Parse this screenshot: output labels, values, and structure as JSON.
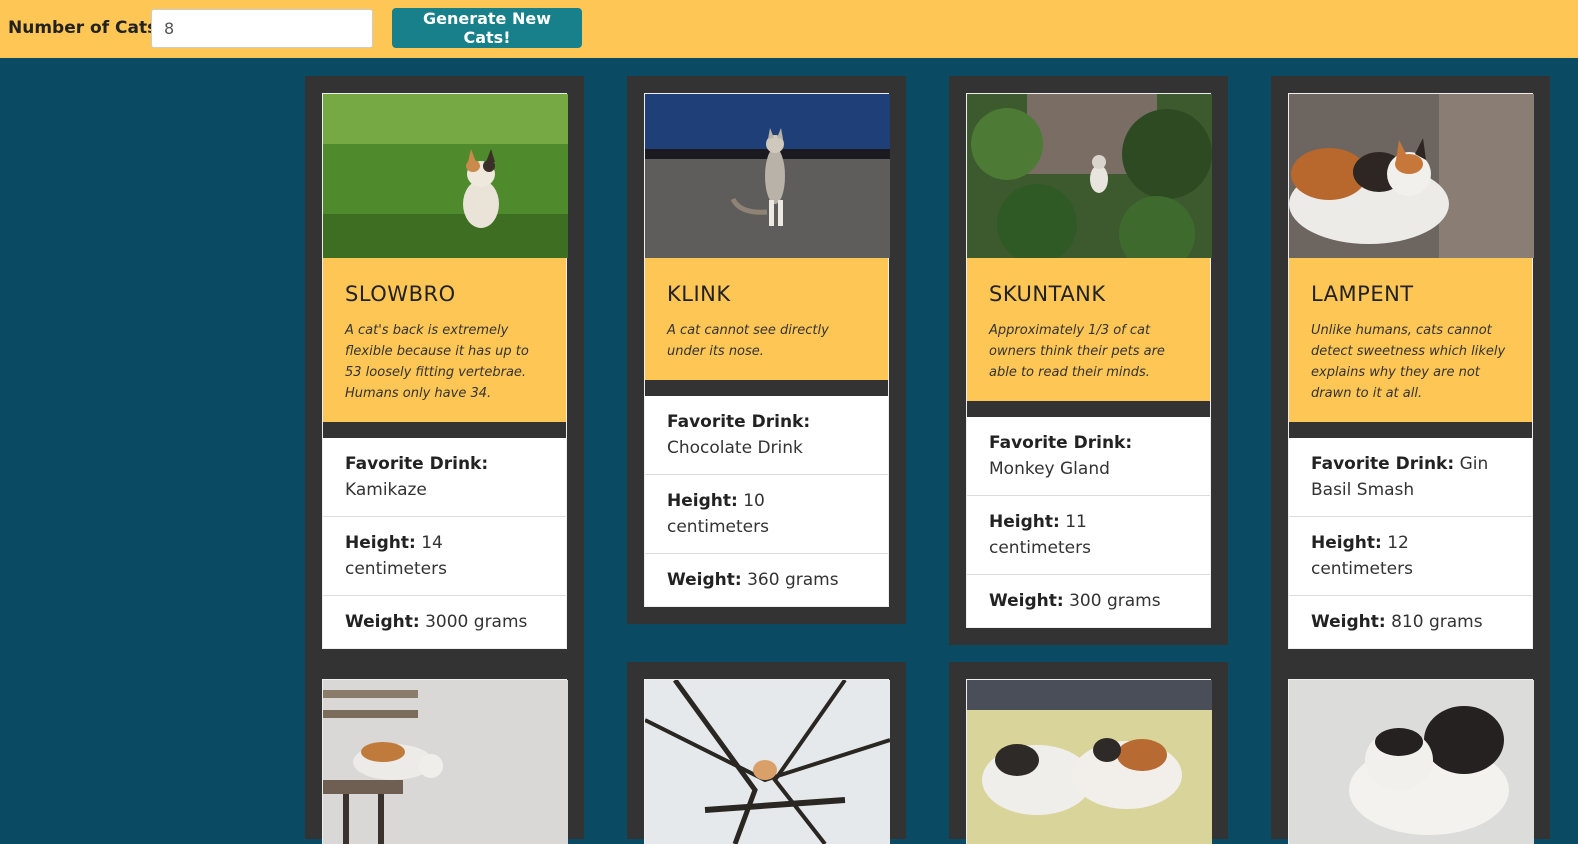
{
  "topbar": {
    "label": "Number of Cats:",
    "count_value": "8",
    "button_label": "Generate New Cats!"
  },
  "stat_labels": {
    "drink": "Favorite Drink:",
    "height": "Height:",
    "weight": "Weight:"
  },
  "cats": [
    {
      "name": "SLOWBRO",
      "fact": "A cat's back is extremely flexible because it has up to 53 loosely fitting vertebrae. Humans only have 34.",
      "drink": "Kamikaze",
      "height": "14 centimeters",
      "weight": "3000 grams"
    },
    {
      "name": "KLINK",
      "fact": "A cat cannot see directly under its nose.",
      "drink": "Chocolate Drink",
      "height": "10 centimeters",
      "weight": "360 grams"
    },
    {
      "name": "SKUNTANK",
      "fact": "Approximately 1/3 of cat owners think their pets are able to read their minds.",
      "drink": "Monkey Gland",
      "height": "11 centimeters",
      "weight": "300 grams"
    },
    {
      "name": "LAMPENT",
      "fact": "Unlike humans, cats cannot detect sweetness which likely explains why they are not drawn to it at all.",
      "drink": "Gin Basil Smash",
      "height": "12 centimeters",
      "weight": "810 grams"
    }
  ],
  "colors": {
    "background": "#0b4a63",
    "accent_yellow": "#fec655",
    "button_teal": "#17808a",
    "card_dark": "#333333"
  }
}
